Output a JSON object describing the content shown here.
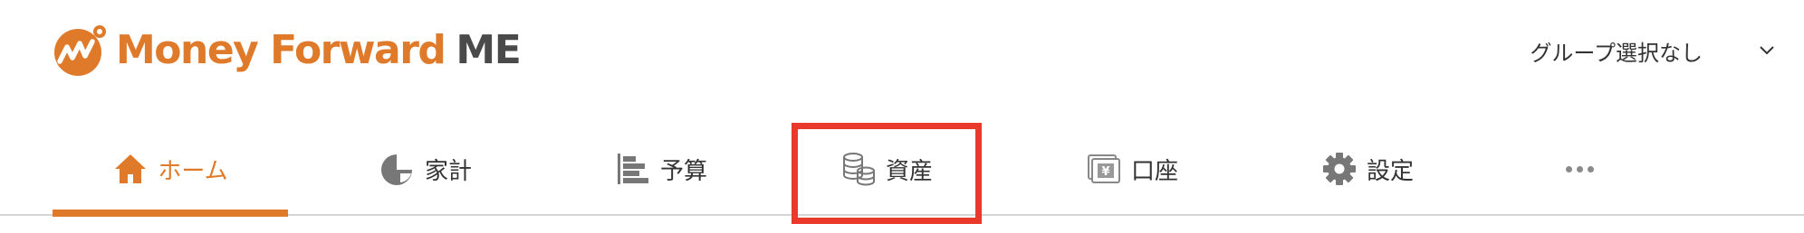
{
  "header": {
    "brand_name": "Money Forward",
    "brand_suffix": "ME",
    "brand_color": "#E07A2B",
    "group_select_label": "グループ選択なし"
  },
  "nav": {
    "items": [
      {
        "label": "ホーム",
        "icon": "home-icon",
        "active": true
      },
      {
        "label": "家計",
        "icon": "pie-chart-icon",
        "active": false
      },
      {
        "label": "予算",
        "icon": "budget-bars-icon",
        "active": false
      },
      {
        "label": "資産",
        "icon": "coins-stack-icon",
        "active": false,
        "highlighted": true
      },
      {
        "label": "口座",
        "icon": "bank-card-icon",
        "active": false
      },
      {
        "label": "設定",
        "icon": "gear-icon",
        "active": false
      }
    ],
    "more_icon": "more-horizontal-icon",
    "active_color": "#E07A2B",
    "highlight_color": "#E8392B"
  }
}
